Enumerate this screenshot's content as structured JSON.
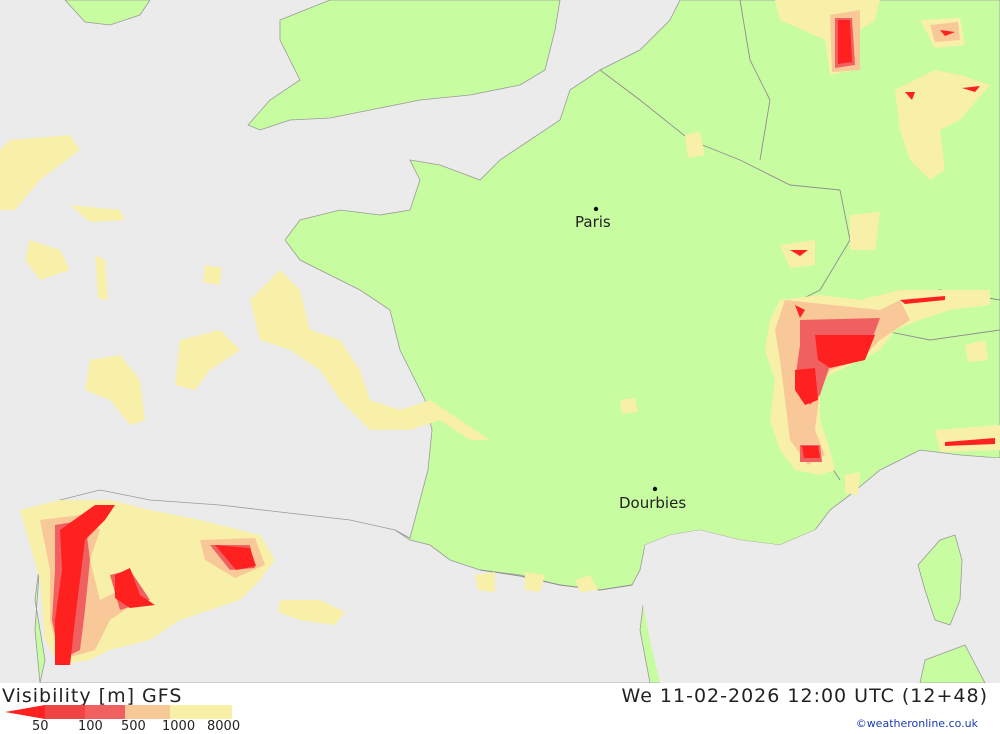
{
  "map": {
    "cities": [
      {
        "name": "Paris"
      },
      {
        "name": "Dourbies"
      }
    ],
    "colors": {
      "sea": "#ebebeb",
      "land": "#c8fca0",
      "vis_8000": "#f8f0a8",
      "vis_1000": "#f8c898",
      "vis_500": "#f06060",
      "vis_100": "#f04444",
      "vis_50": "#ff2020",
      "border": "#9a9a9a"
    }
  },
  "footer": {
    "title_left": "Visibility [m] GFS",
    "title_right": "We 11-02-2026 12:00 UTC (12+48)",
    "credit": "©weatheronline.co.uk",
    "legend": [
      "50",
      "100",
      "500",
      "1000",
      "8000"
    ]
  }
}
